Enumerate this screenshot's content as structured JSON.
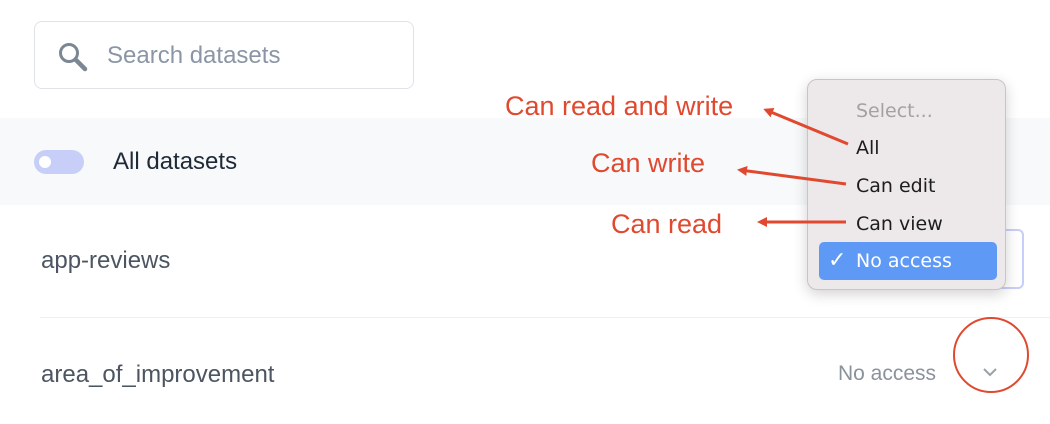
{
  "search": {
    "placeholder": "Search datasets",
    "value": ""
  },
  "all_datasets": {
    "label": "All datasets",
    "toggle_on": false
  },
  "datasets": [
    {
      "name": "app-reviews"
    },
    {
      "name": "area_of_improvement",
      "access": "No access"
    }
  ],
  "access_menu": {
    "header": "Select...",
    "options": [
      "All",
      "Can edit",
      "Can view",
      "No access"
    ],
    "selected": "No access",
    "check": "✓"
  },
  "annotations": {
    "all": "Can read and write",
    "edit": "Can write",
    "view": "Can read"
  },
  "colors": {
    "annotation": "#e0492f",
    "selected": "#5e99f5",
    "toggle": "#c7cff8"
  }
}
